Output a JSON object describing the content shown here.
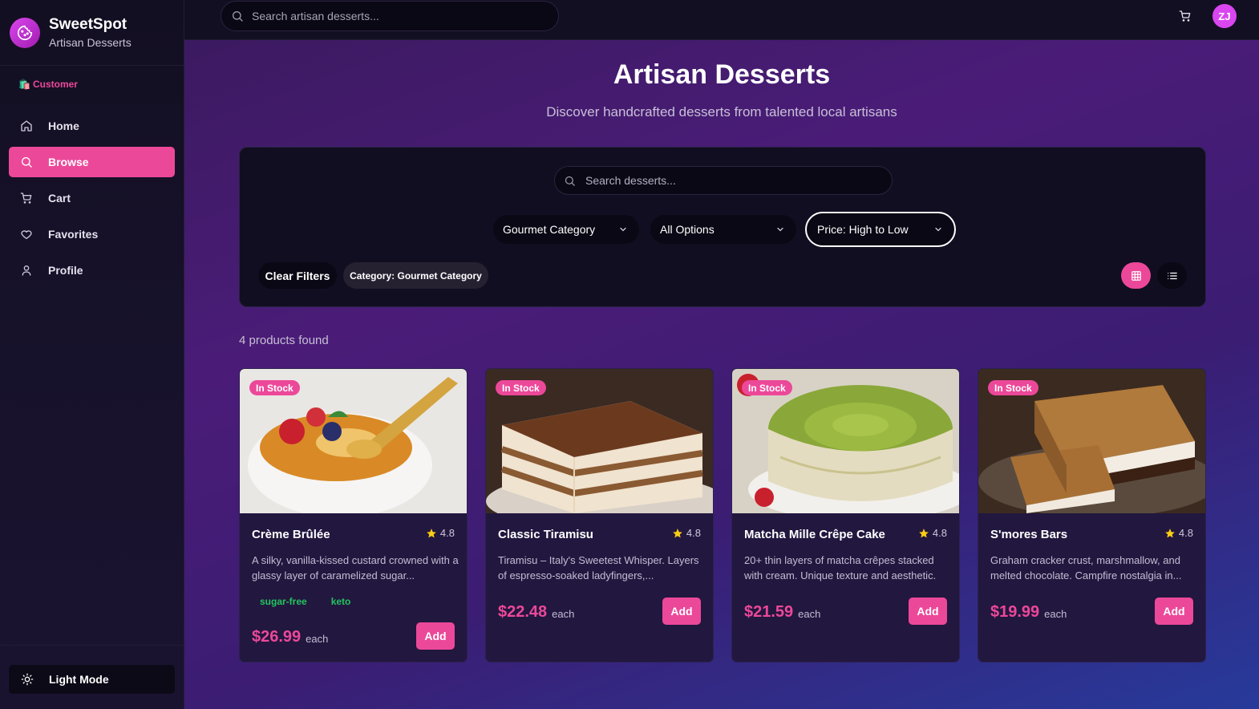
{
  "brand": {
    "name": "SweetSpot",
    "subtitle": "Artisan Desserts"
  },
  "role": "Customer",
  "nav": [
    {
      "label": "Home",
      "icon": "home-icon"
    },
    {
      "label": "Browse",
      "icon": "search-icon",
      "active": true
    },
    {
      "label": "Cart",
      "icon": "cart-icon"
    },
    {
      "label": "Favorites",
      "icon": "heart-icon"
    },
    {
      "label": "Profile",
      "icon": "user-icon"
    }
  ],
  "theme_toggle": {
    "label": "Light Mode",
    "icon": "sun-icon"
  },
  "topbar": {
    "search_placeholder": "Search artisan desserts...",
    "avatar_initials": "ZJ"
  },
  "page": {
    "title": "Artisan Desserts",
    "subtitle": "Discover handcrafted desserts from talented local artisans"
  },
  "filters": {
    "search_placeholder": "Search desserts...",
    "category": "Gourmet Category",
    "options": "All Options",
    "sort": "Price: High to Low",
    "clear_label": "Clear Filters",
    "active_chip": "Category: Gourmet Category"
  },
  "results_count": "4 products found",
  "colors": {
    "accent": "#ec4899",
    "tag": "#22c55e",
    "star": "#facc15"
  },
  "products": [
    {
      "name": "Crème Brûlée",
      "rating": "4.8",
      "badge": "In Stock",
      "description": "A silky, vanilla-kissed custard crowned with a glassy layer of caramelized sugar...",
      "tags": [
        "sugar-free",
        "keto"
      ],
      "price": "$26.99",
      "unit": "each",
      "add_label": "Add"
    },
    {
      "name": "Classic Tiramisu",
      "rating": "4.8",
      "badge": "In Stock",
      "description": "Tiramisu – Italy's Sweetest Whisper. Layers of espresso-soaked ladyfingers,...",
      "tags": [],
      "price": "$22.48",
      "unit": "each",
      "add_label": "Add"
    },
    {
      "name": "Matcha Mille Crêpe Cake",
      "rating": "4.8",
      "badge": "In Stock",
      "description": "20+ thin layers of matcha crêpes stacked with cream. Unique texture and aesthetic.",
      "tags": [],
      "price": "$21.59",
      "unit": "each",
      "add_label": "Add"
    },
    {
      "name": "S'mores Bars",
      "rating": "4.8",
      "badge": "In Stock",
      "description": "Graham cracker crust, marshmallow, and melted chocolate. Campfire nostalgia in...",
      "tags": [],
      "price": "$19.99",
      "unit": "each",
      "add_label": "Add"
    }
  ]
}
